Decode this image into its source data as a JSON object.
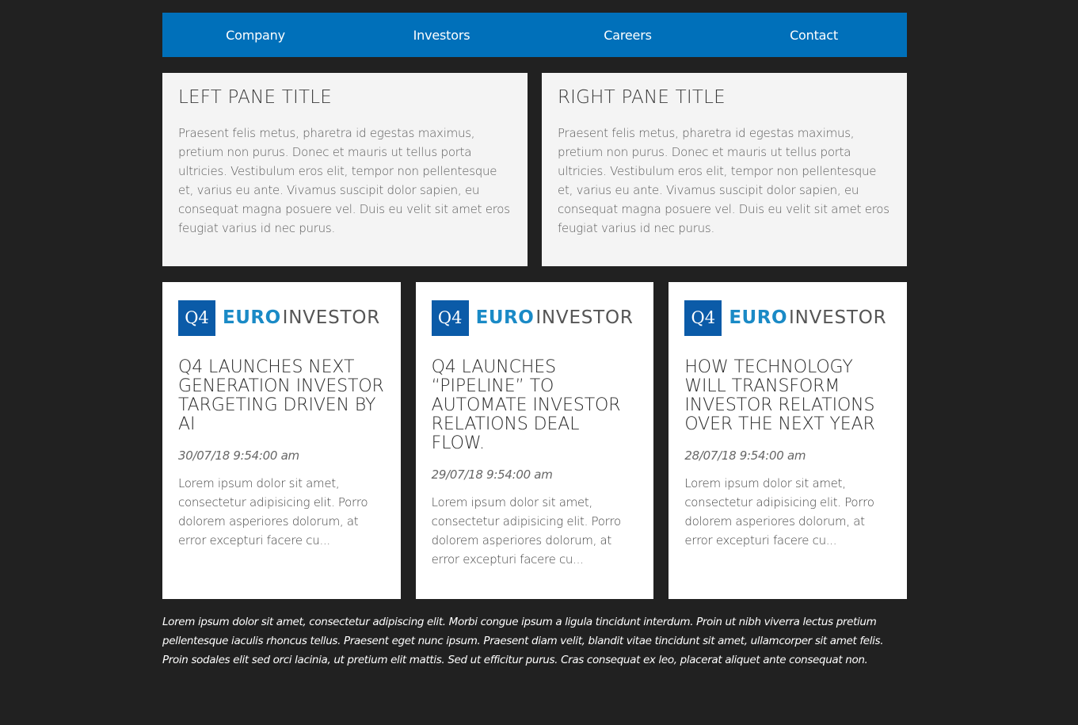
{
  "nav": {
    "items": [
      "Company",
      "Investors",
      "Careers",
      "Contact"
    ],
    "color": "#0070ba"
  },
  "panes": [
    {
      "title": "LEFT PANE TITLE",
      "body": "Praesent felis metus, pharetra id egestas maximus, pretium non purus. Donec et mauris ut tellus porta ultricies. Vestibulum eros elit, tempor non pellentesque et, varius eu ante. Vivamus suscipit dolor sapien, eu consequat magna posuere vel. Duis eu velit sit amet eros feugiat varius id nec purus."
    },
    {
      "title": "RIGHT PANE TITLE",
      "body": "Praesent felis metus, pharetra id egestas maximus, pretium non purus. Donec et mauris ut tellus porta ultricies. Vestibulum eros elit, tempor non pellentesque et, varius eu ante. Vivamus suscipit dolor sapien, eu consequat magna posuere vel. Duis eu velit sit amet eros feugiat varius id nec purus."
    }
  ],
  "logo": {
    "mark": "Q4",
    "euro": "EURO",
    "investor": "INVESTOR"
  },
  "cards": [
    {
      "title": "Q4 LAUNCHES NEXT GENERATION INVESTOR TARGETING DRIVEN BY AI",
      "date": "30/07/18 9:54:00 am",
      "excerpt": "Lorem ipsum dolor sit amet, consectetur adipisicing elit. Porro dolorem asperiores dolorum, at error excepturi facere cu..."
    },
    {
      "title": "Q4 LAUNCHES “PIPELINE” TO AUTOMATE INVESTOR RELATIONS DEAL FLOW.",
      "date": "29/07/18 9:54:00 am",
      "excerpt": "Lorem ipsum dolor sit amet, consectetur adipisicing elit. Porro dolorem asperiores dolorum, at error excepturi facere cu..."
    },
    {
      "title": "HOW TECHNOLOGY WILL TRANSFORM INVESTOR RELATIONS OVER THE NEXT YEAR",
      "date": "28/07/18 9:54:00 am",
      "excerpt": "Lorem ipsum dolor sit amet, consectetur adipisicing elit. Porro dolorem asperiores dolorum, at error excepturi facere cu..."
    }
  ],
  "footer": {
    "text": "Lorem ipsum dolor sit amet, consectetur adipiscing elit. Morbi congue ipsum a ligula tincidunt interdum. Proin ut nibh viverra lectus pretium pellentesque iaculis rhoncus tellus. Praesent eget nunc ipsum. Praesent diam velit, blandit vitae tincidunt sit amet, ullamcorper sit amet felis. Proin sodales elit sed orci lacinia, ut pretium elit mattis. Sed ut efficitur purus. Cras consequat ex leo, placerat aliquet ante consequat non."
  }
}
